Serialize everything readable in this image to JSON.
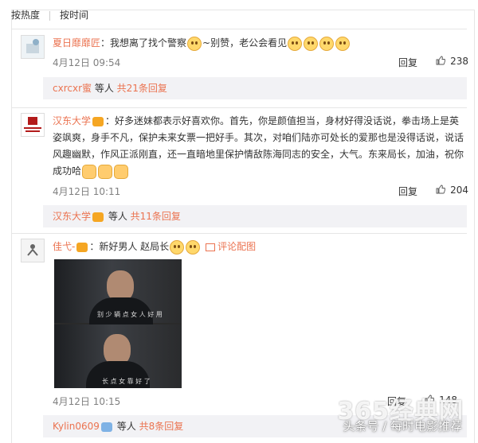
{
  "tabs": {
    "hot": "按热度",
    "time": "按时间"
  },
  "comments": [
    {
      "user": "夏日靡靡匠",
      "text_a": "：我想离了找个警察",
      "text_b": "~别赞，老公会看见",
      "time": "4月12日 09:54",
      "reply": "回复",
      "likes": "238",
      "sub": {
        "name": "cxrcxr蜜",
        "mid": " 等人 ",
        "count": "共21条回复"
      }
    },
    {
      "user": "汉东大学",
      "avatar_text": "汉东大学",
      "text": "：好多迷妹都表示好喜欢你。首先，你是颜值担当，身材好得没话说，拳击场上是英姿飒爽，身手不凡，保护未来女票一把好手。其次，对咱们陆亦可处长的爱那也是没得话说，说话风趣幽默，作风正派刚直，还一直暗地里保护情敌陈海同志的安全，大气。东来局长，加油，祝你成功哈",
      "time": "4月12日 10:11",
      "reply": "回复",
      "likes": "204",
      "sub": {
        "name": "汉东大学",
        "mid": " 等人 ",
        "count": "共11条回复"
      }
    },
    {
      "user": "佳弋-",
      "text": "：新好男人 赵局长",
      "pic_link": "评论配图",
      "photo_caption_1": "别 少 辆 点 女 人 好 用",
      "photo_caption_2": "长 点 女 靠 好 了",
      "time": "4月12日 10:15",
      "reply": "回复",
      "likes": "148",
      "sub": {
        "name": "Kylin0609",
        "mid": " 等人 ",
        "count": "共8条回复"
      }
    }
  ],
  "watermark": {
    "big": "365经典网",
    "small": "头条号 / 每时电影推荐"
  },
  "colors": {
    "link": "#eb7350",
    "subbar": "#f2f2f5",
    "divider": "#e6e6e6"
  }
}
